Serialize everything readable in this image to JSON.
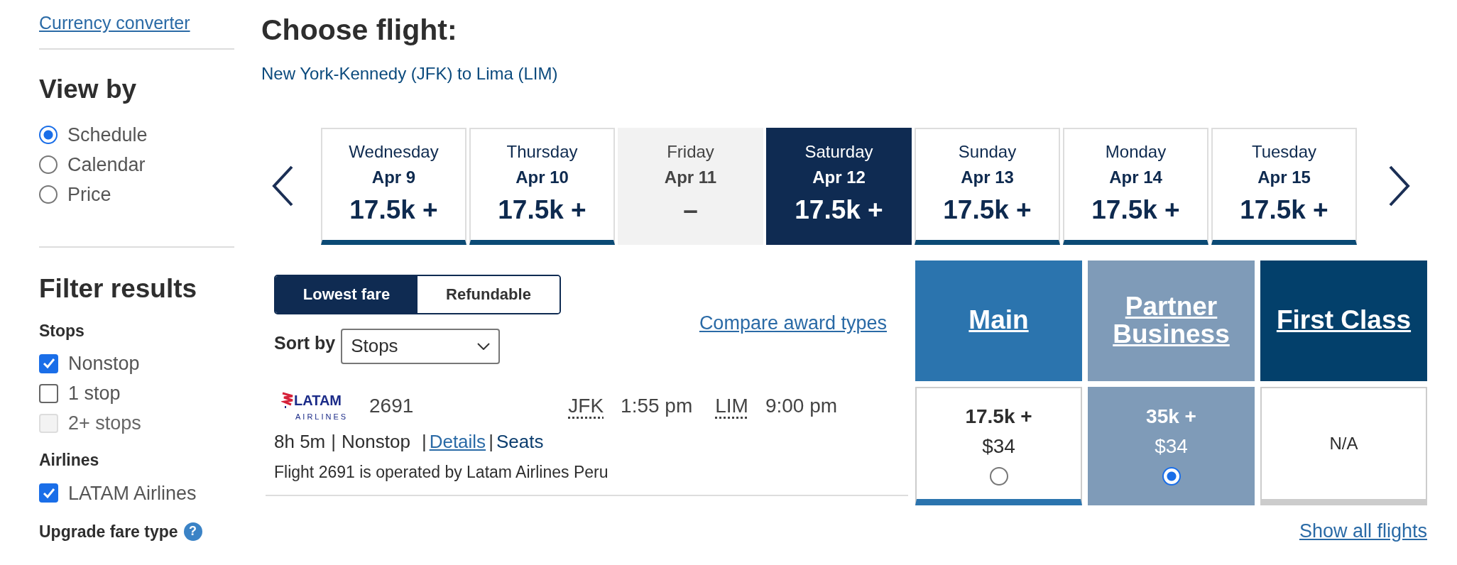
{
  "sidebar": {
    "currency_link": "Currency converter",
    "view_by": {
      "title": "View by",
      "options": [
        {
          "label": "Schedule",
          "selected": true
        },
        {
          "label": "Calendar",
          "selected": false
        },
        {
          "label": "Price",
          "selected": false
        }
      ]
    },
    "filter_title": "Filter results",
    "stops": {
      "title": "Stops",
      "options": [
        {
          "label": "Nonstop",
          "checked": true,
          "disabled": false
        },
        {
          "label": "1 stop",
          "checked": false,
          "disabled": false
        },
        {
          "label": "2+ stops",
          "checked": false,
          "disabled": true
        }
      ]
    },
    "airlines": {
      "title": "Airlines",
      "options": [
        {
          "label": "LATAM Airlines",
          "checked": true,
          "disabled": false
        }
      ]
    },
    "upgrade": {
      "title": "Upgrade fare type",
      "help": "?"
    }
  },
  "title": "Choose flight:",
  "route": "New York-Kennedy (JFK) to Lima (LIM)",
  "dates": [
    {
      "day": "Wednesday",
      "date": "Apr 9",
      "price": "17.5k +",
      "available": true,
      "selected": false
    },
    {
      "day": "Thursday",
      "date": "Apr 10",
      "price": "17.5k +",
      "available": true,
      "selected": false
    },
    {
      "day": "Friday",
      "date": "Apr 11",
      "price": "–",
      "available": false,
      "selected": false
    },
    {
      "day": "Saturday",
      "date": "Apr 12",
      "price": "17.5k +",
      "available": true,
      "selected": true
    },
    {
      "day": "Sunday",
      "date": "Apr 13",
      "price": "17.5k +",
      "available": true,
      "selected": false
    },
    {
      "day": "Monday",
      "date": "Apr 14",
      "price": "17.5k +",
      "available": true,
      "selected": false
    },
    {
      "day": "Tuesday",
      "date": "Apr 15",
      "price": "17.5k +",
      "available": true,
      "selected": false
    }
  ],
  "fare_toggle": [
    {
      "label": "Lowest fare",
      "selected": true
    },
    {
      "label": "Refundable",
      "selected": false
    }
  ],
  "sort": {
    "label": "Sort by",
    "value": "Stops"
  },
  "compare_link": "Compare award types",
  "fare_columns": [
    {
      "title": "Main",
      "color": "#2b74ae"
    },
    {
      "title": "Partner Business",
      "color": "#7f9bb8"
    },
    {
      "title": "First Class",
      "color": "#03406b"
    }
  ],
  "flight": {
    "logo_name": "LATAM",
    "logo_sub": "AIRLINES",
    "number": "2691",
    "from": "JFK",
    "depart": "1:55 pm",
    "to": "LIM",
    "arrive": "9:00 pm",
    "duration": "8h 5m",
    "separators": [
      "|",
      "|",
      "|"
    ],
    "stops": "Nonstop",
    "details_link": "Details",
    "seats_link": "Seats",
    "operated": "Flight 2691 is operated by Latam Airlines Peru",
    "fares": [
      {
        "kind": "price",
        "points": "17.5k +",
        "cash": "$34",
        "selected": false
      },
      {
        "kind": "price",
        "points": "35k +",
        "cash": "$34",
        "selected": true
      },
      {
        "kind": "na",
        "text": "N/A"
      }
    ]
  },
  "show_all": "Show all flights"
}
